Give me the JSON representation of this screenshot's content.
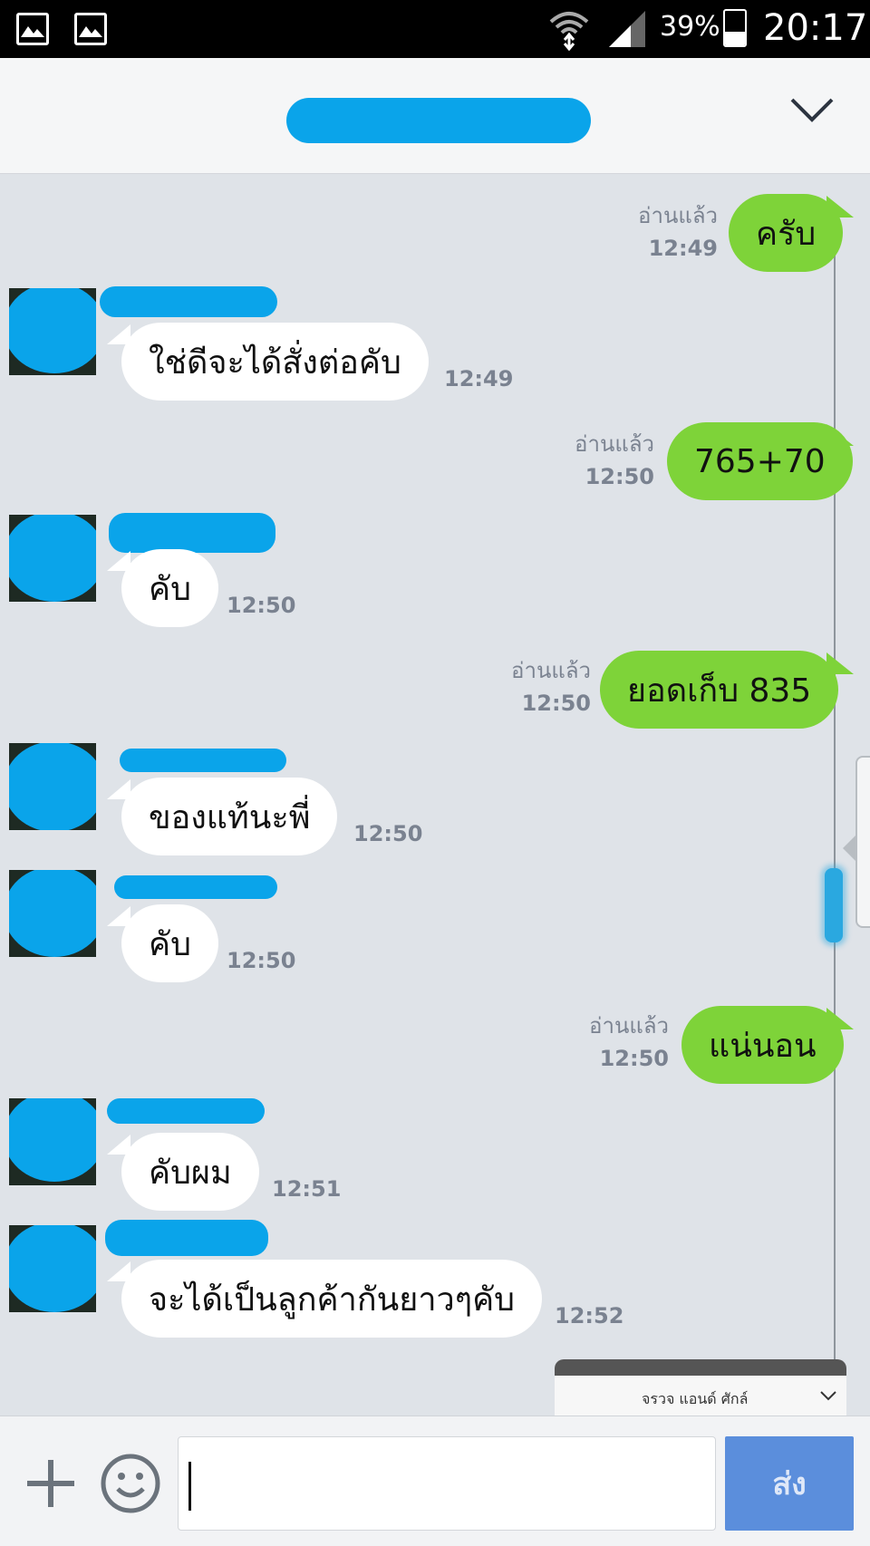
{
  "status_bar": {
    "icons": [
      "image-icon",
      "image-icon",
      "wifi-icon",
      "signal-icon",
      "battery-icon"
    ],
    "battery": "39%",
    "time": "20:17"
  },
  "header": {
    "title": "",
    "chevron": "chevron-down-icon"
  },
  "messages": [
    {
      "side": "out",
      "text": "ครับ",
      "read": "อ่านแล้ว",
      "time": "12:49"
    },
    {
      "side": "in",
      "text": "ใช่ดีจะได้สั่งต่อคับ",
      "time": "12:49"
    },
    {
      "side": "out",
      "text": "765+70",
      "read": "อ่านแล้ว",
      "time": "12:50"
    },
    {
      "side": "in",
      "text": "คับ",
      "time": "12:50"
    },
    {
      "side": "out",
      "text": "ยอดเก็บ 835",
      "read": "อ่านแล้ว",
      "time": "12:50"
    },
    {
      "side": "in",
      "text": "ของแท้นะพี่",
      "time": "12:50"
    },
    {
      "side": "in",
      "text": "คับ",
      "time": "12:50"
    },
    {
      "side": "out",
      "text": "แน่นอน",
      "read": "อ่านแล้ว",
      "time": "12:50"
    },
    {
      "side": "in",
      "text": "คับผม",
      "time": "12:51"
    },
    {
      "side": "in",
      "text": "จะได้เป็นลูกค้ากันยาวๆคับ",
      "time": "12:52"
    }
  ],
  "preview": {
    "title": "จรวจ แอนด์ ศักล์"
  },
  "input": {
    "value": "",
    "send_label": "ส่ง"
  },
  "colors": {
    "outgoing_bubble": "#7ed339",
    "incoming_bubble": "#ffffff",
    "chat_background": "#dfe3e8",
    "send_button": "#5b8edc",
    "redaction": "#0aa4ea"
  }
}
